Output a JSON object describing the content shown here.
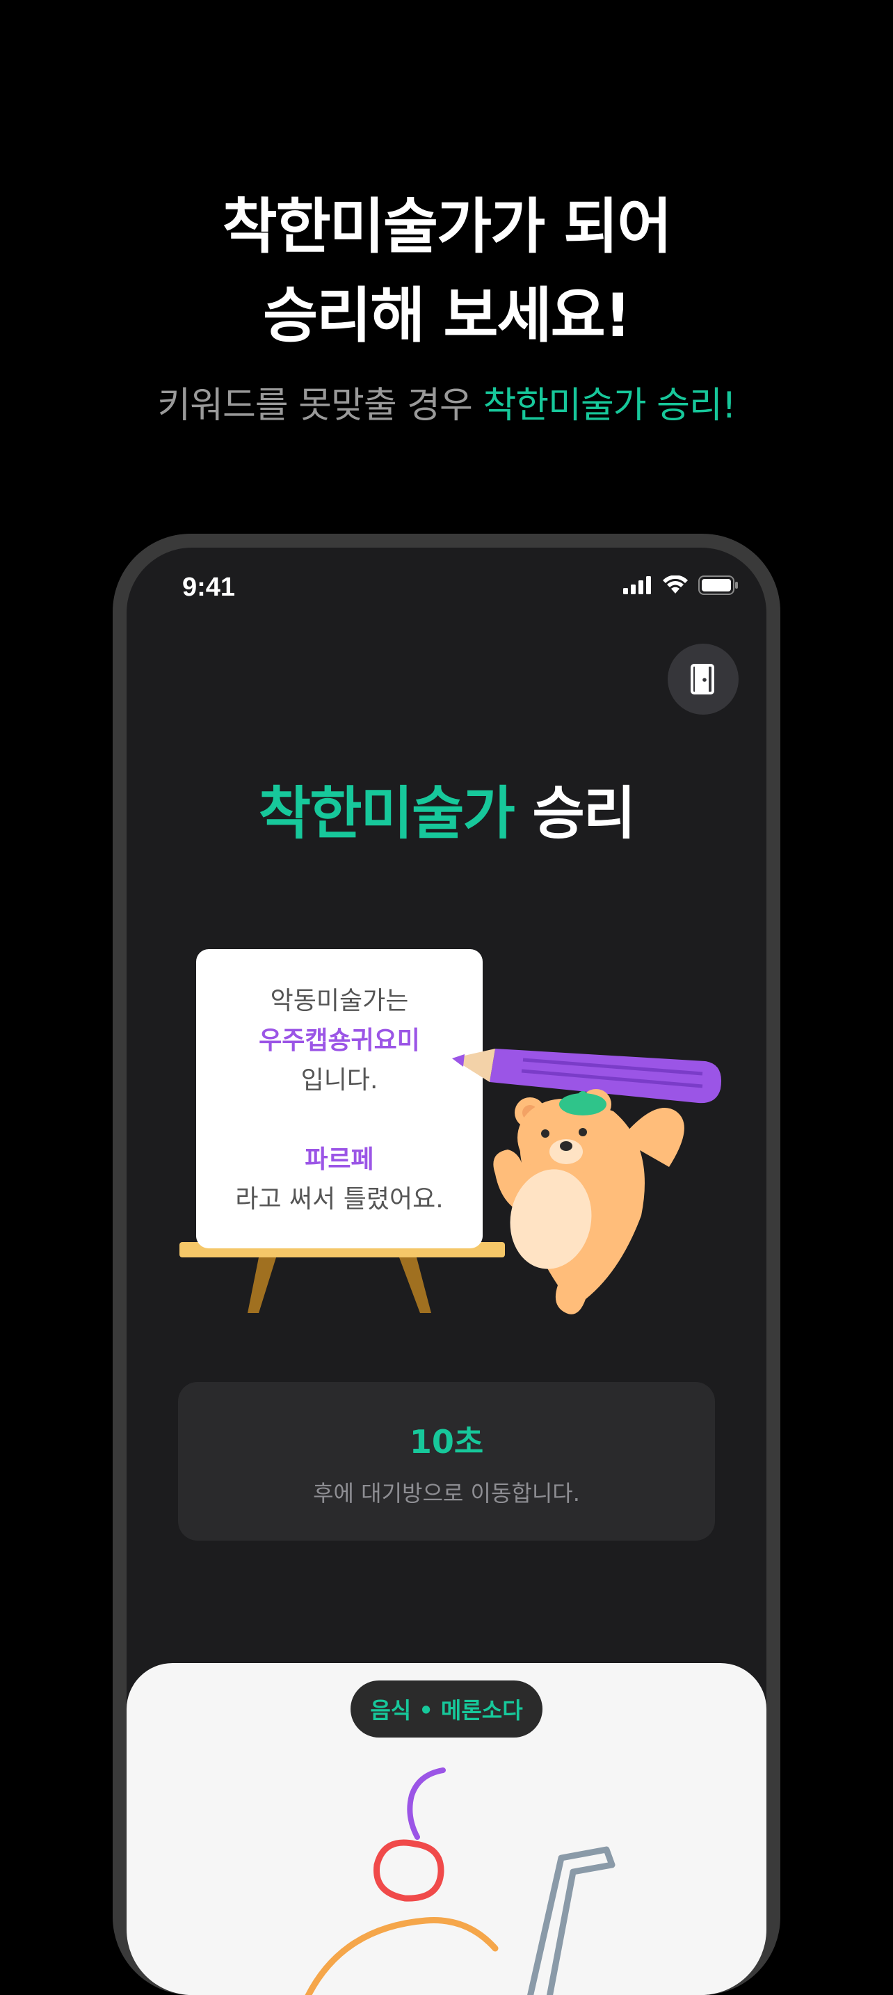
{
  "headline": {
    "line1": "착한미술가가 되어",
    "line2": "승리해 보세요!"
  },
  "subline": {
    "prefix": "키워드를 못맞출 경우 ",
    "accent": "착한미술가 승리",
    "suffix": "!"
  },
  "status_bar": {
    "time": "9:41",
    "icons": [
      "signal-icon",
      "wifi-icon",
      "battery-icon"
    ]
  },
  "game": {
    "exit_icon": "door-exit-icon",
    "result_title_accent": "착한미술가",
    "result_title_rest": " 승리",
    "board": {
      "line1": "악동미술가는",
      "keyword": "우주캡숑귀요미",
      "line3": "입니다.",
      "wrong_answer": "파르페",
      "line5": "라고 써서 틀렸어요."
    },
    "timer": {
      "count": "10초",
      "text": "후에 대기방으로 이동합니다."
    },
    "category_pill": "음식 • 메론소다"
  },
  "colors": {
    "accent": "#17c89b",
    "purple": "#9b55e6",
    "background": "#000000",
    "screen": "#1c1c1e"
  }
}
